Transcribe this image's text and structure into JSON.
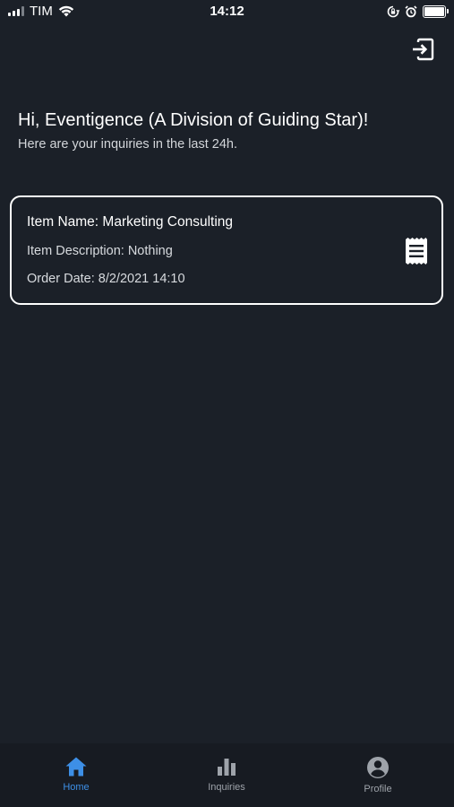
{
  "status_bar": {
    "carrier": "TIM",
    "time": "14:12"
  },
  "header": {
    "logout_icon": "logout-icon"
  },
  "greeting": {
    "title": "Hi, Eventigence (A Division of Guiding Star)!",
    "subtitle": "Here are your inquiries in the last 24h."
  },
  "inquiries": [
    {
      "name": "Item Name: Marketing Consulting",
      "description": "Item Description: Nothing",
      "order_date": "Order Date: 8/2/2021 14:10",
      "icon": "receipt-icon"
    }
  ],
  "nav": {
    "items": [
      {
        "label": "Home",
        "icon": "home-icon",
        "active": true
      },
      {
        "label": "Inquiries",
        "icon": "bar-chart-icon",
        "active": false
      },
      {
        "label": "Profile",
        "icon": "account-circle-icon",
        "active": false
      }
    ]
  },
  "colors": {
    "background": "#1b2028",
    "nav_background": "#171b22",
    "accent": "#3d8fe6",
    "text": "#ffffff",
    "muted": "#9ea3aa"
  }
}
